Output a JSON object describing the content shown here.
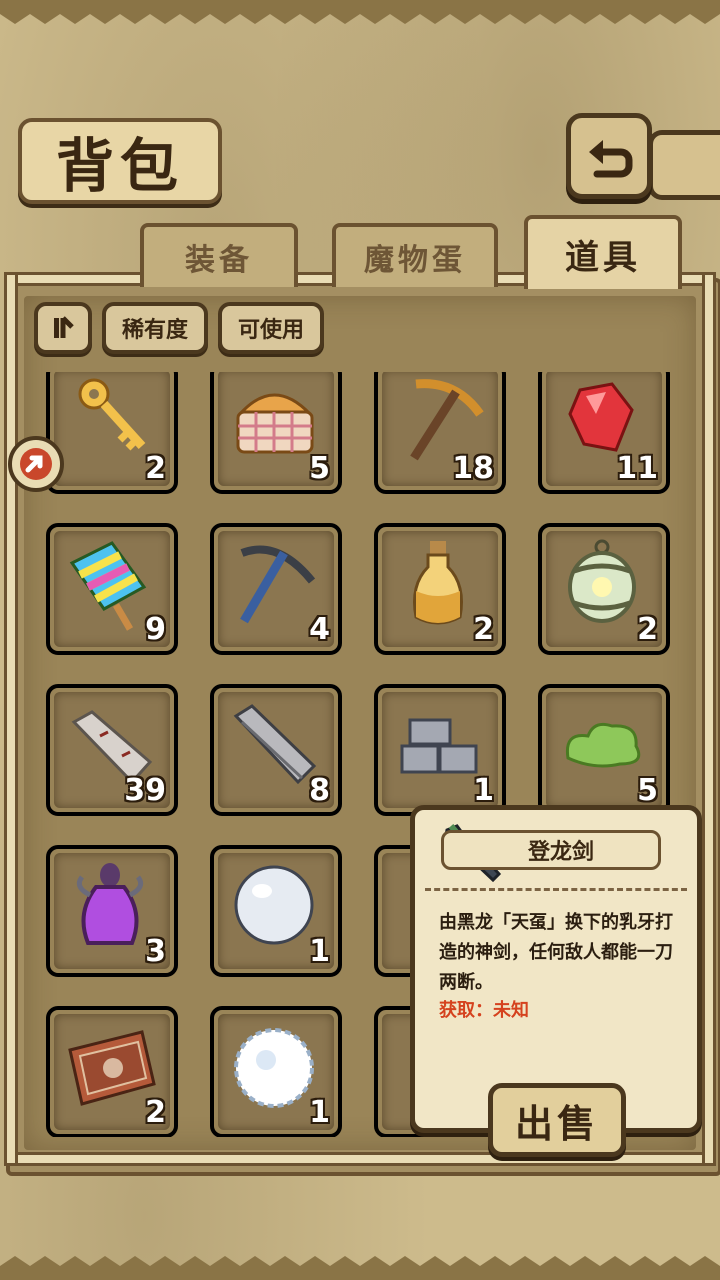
{
  "title": "背包",
  "tabs": [
    {
      "label": "装备",
      "active": false
    },
    {
      "label": "魔物蛋",
      "active": false
    },
    {
      "label": "道具",
      "active": true
    }
  ],
  "filters": {
    "sort_icon": "sort-icon",
    "rarity_label": "稀有度",
    "usable_label": "可使用"
  },
  "rarity_colors": {
    "yellow": "#f4b23a",
    "pink": "#e764c6",
    "green": "#6a9a3c",
    "blue": "#4257c9",
    "plain": "#e9dcb4"
  },
  "items": [
    {
      "icon": "golden-key-icon",
      "count": "2",
      "rarity": "yellow"
    },
    {
      "icon": "bread-basket-icon",
      "count": "5",
      "rarity": "pink"
    },
    {
      "icon": "pickaxe-icon",
      "count": "18",
      "rarity": "green"
    },
    {
      "icon": "red-gem-icon",
      "count": "11",
      "rarity": "blue"
    },
    {
      "icon": "rainbow-popsicle-icon",
      "count": "9",
      "rarity": "pink"
    },
    {
      "icon": "iron-pickaxe-icon",
      "count": "4",
      "rarity": "blue"
    },
    {
      "icon": "potion-bottle-icon",
      "count": "2",
      "rarity": "plain"
    },
    {
      "icon": "lantern-icon",
      "count": "2",
      "rarity": "pink"
    },
    {
      "icon": "stone-pillar-icon",
      "count": "39",
      "rarity": "plain"
    },
    {
      "icon": "iron-bar-icon",
      "count": "8",
      "rarity": "green"
    },
    {
      "icon": "stone-blocks-icon",
      "count": "1",
      "rarity": "plain"
    },
    {
      "icon": "green-slime-icon",
      "count": "5",
      "rarity": "plain"
    },
    {
      "icon": "purple-vase-icon",
      "count": "3",
      "rarity": "pink"
    },
    {
      "icon": "pearl-orb-icon",
      "count": "1",
      "rarity": "green"
    },
    {
      "icon": "hidden-item-icon",
      "count": "",
      "rarity": "green"
    },
    {
      "icon": "hidden-item-icon",
      "count": "",
      "rarity": "plain"
    },
    {
      "icon": "map-scroll-icon",
      "count": "2",
      "rarity": "pink"
    },
    {
      "icon": "snowball-icon",
      "count": "1",
      "rarity": "plain"
    },
    {
      "icon": "hidden-item-icon",
      "count": "",
      "rarity": "green"
    },
    {
      "icon": "hidden-item-icon",
      "count": "",
      "rarity": "plain"
    }
  ],
  "tooltip": {
    "name": "登龙剑",
    "icon": "dark-sword-icon",
    "description": "由黑龙「天虿」换下的乳牙打造的神剑，任何敌人都能一刀两断。",
    "source": "获取：未知",
    "sell_label": "出售"
  }
}
